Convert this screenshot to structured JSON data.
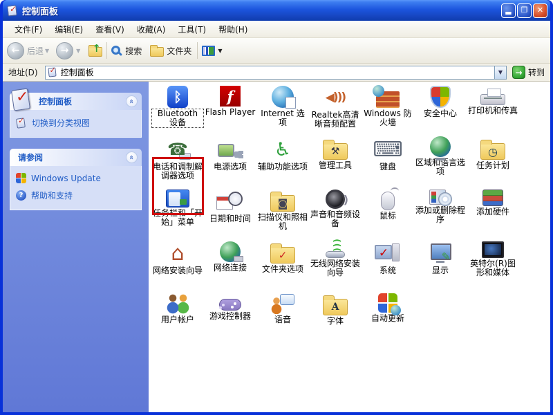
{
  "colors": {
    "frame": "#0831D9",
    "title_top": "#3D7DF0",
    "title_bottom": "#1645BE",
    "sidebar_top": "#8099E2",
    "sidebar_bottom": "#6078D6",
    "panel_body": "#D6DFF7",
    "link": "#215DC6",
    "annotation": "#CE0E0E",
    "go_green": "#37A837"
  },
  "window": {
    "title": "控制面板"
  },
  "menu_bar": {
    "items": [
      {
        "id": "file",
        "label": "文件(F)"
      },
      {
        "id": "edit",
        "label": "编辑(E)"
      },
      {
        "id": "view",
        "label": "查看(V)"
      },
      {
        "id": "favorites",
        "label": "收藏(A)"
      },
      {
        "id": "tools",
        "label": "工具(T)"
      },
      {
        "id": "help",
        "label": "帮助(H)"
      }
    ]
  },
  "toolbar": {
    "back_label": "后退",
    "search_label": "搜索",
    "folders_label": "文件夹"
  },
  "address_bar": {
    "label": "地址(D)",
    "value": "控制面板",
    "go_label": "转到"
  },
  "sidebar": {
    "panel1": {
      "title": "控制面板",
      "items": [
        {
          "id": "switch-category-view",
          "label": "切换到分类视图"
        }
      ]
    },
    "panel2": {
      "title": "请参阅",
      "items": [
        {
          "id": "windows-update",
          "label": "Windows Update"
        },
        {
          "id": "help-support",
          "label": "帮助和支持"
        }
      ]
    }
  },
  "grid": {
    "items": [
      {
        "id": "bluetooth-devices",
        "label": "Bluetooth 设备",
        "glyph": "ᛒ",
        "selected": true
      },
      {
        "id": "flash-player",
        "label": "Flash Player",
        "glyph": "f"
      },
      {
        "id": "internet-options",
        "label": "Internet 选项",
        "glyph": ""
      },
      {
        "id": "realtek-audio",
        "label": "Realtek高清晰音频配置",
        "glyph": "◀)))"
      },
      {
        "id": "windows-firewall",
        "label": "Windows 防火墙",
        "glyph": ""
      },
      {
        "id": "security-center",
        "label": "安全中心",
        "glyph": ""
      },
      {
        "id": "printers-faxes",
        "label": "打印机和传真",
        "glyph": ""
      },
      {
        "id": "phone-modem-options",
        "label": "电话和调制解调器选项",
        "glyph": "☎"
      },
      {
        "id": "power-options",
        "label": "电源选项",
        "glyph": ""
      },
      {
        "id": "accessibility-options",
        "label": "辅助功能选项",
        "glyph": "♿"
      },
      {
        "id": "administrative-tools",
        "label": "管理工具",
        "glyph": "⚒"
      },
      {
        "id": "keyboard",
        "label": "键盘",
        "glyph": "⌨"
      },
      {
        "id": "regional-language-options",
        "label": "区域和语言选项",
        "glyph": ""
      },
      {
        "id": "scheduled-tasks",
        "label": "任务计划",
        "glyph": "◷"
      },
      {
        "id": "taskbar-start-menu",
        "label": "任务栏和「开始」菜单",
        "glyph": ""
      },
      {
        "id": "date-time",
        "label": "日期和时间",
        "glyph": ""
      },
      {
        "id": "scanners-cameras",
        "label": "扫描仪和照相机",
        "glyph": "◙"
      },
      {
        "id": "sounds-audio-devices",
        "label": "声音和音频设备",
        "glyph": ""
      },
      {
        "id": "mouse",
        "label": "鼠标",
        "glyph": ""
      },
      {
        "id": "add-remove-programs",
        "label": "添加或删除程序",
        "glyph": ""
      },
      {
        "id": "add-hardware",
        "label": "添加硬件",
        "glyph": ""
      },
      {
        "id": "network-setup-wizard",
        "label": "网络安装向导",
        "glyph": "⌂"
      },
      {
        "id": "network-connections",
        "label": "网络连接",
        "glyph": ""
      },
      {
        "id": "folder-options",
        "label": "文件夹选项",
        "glyph": "✓"
      },
      {
        "id": "wireless-network-setup-wizard",
        "label": "无线网络安装向导",
        "glyph": ""
      },
      {
        "id": "system",
        "label": "系统",
        "glyph": "✓"
      },
      {
        "id": "display",
        "label": "显示",
        "glyph": "✎"
      },
      {
        "id": "intel-graphics-media",
        "label": "英特尔(R)图形和媒体",
        "glyph": ""
      },
      {
        "id": "user-accounts",
        "label": "用户帐户",
        "glyph": ""
      },
      {
        "id": "game-controllers",
        "label": "游戏控制器",
        "glyph": ""
      },
      {
        "id": "speech",
        "label": "语音",
        "glyph": ""
      },
      {
        "id": "fonts",
        "label": "字体",
        "glyph": "A"
      },
      {
        "id": "automatic-updates",
        "label": "自动更新",
        "glyph": ""
      }
    ]
  }
}
